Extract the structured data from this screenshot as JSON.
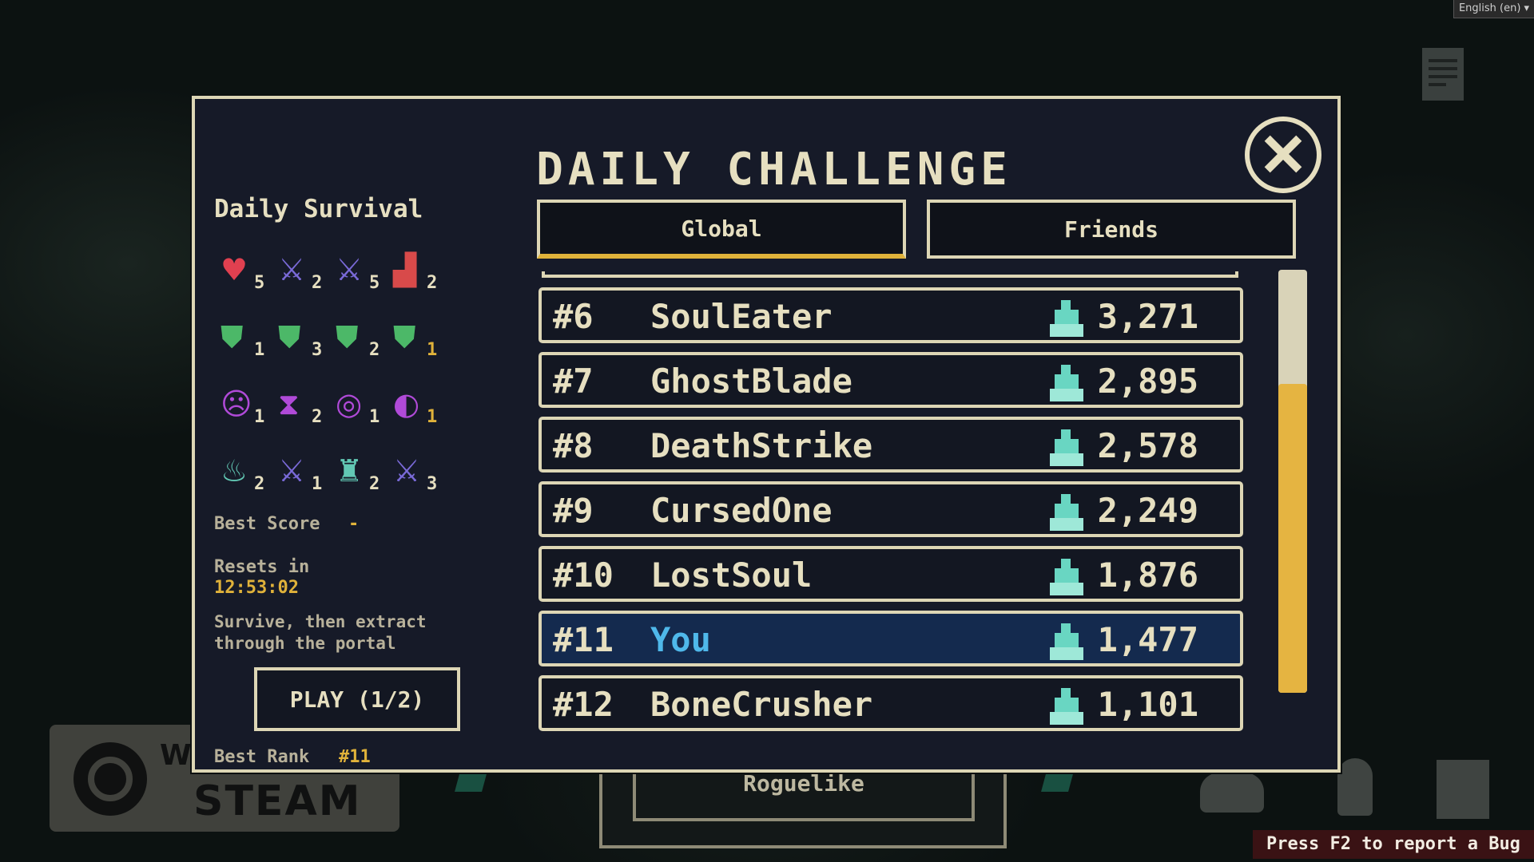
{
  "language_select": "English (en) ▾",
  "background_labels": {
    "steam_top": "WI",
    "steam": "STEAM",
    "under_button": "Roguelike",
    "bug_report": "Press F2 to report a Bug"
  },
  "dialog": {
    "title": "DAILY CHALLENGE",
    "mode_title": "Daily Survival",
    "stats": [
      [
        {
          "icon": "heart-icon",
          "glyph": "♥",
          "color": "#e04050",
          "count": "5"
        },
        {
          "icon": "sword-up-icon",
          "glyph": "⚔",
          "color": "#7a6ad8",
          "count": "2"
        },
        {
          "icon": "sword-bolt-icon",
          "glyph": "⚔",
          "color": "#7a6ad8",
          "count": "5"
        },
        {
          "icon": "boot-icon",
          "glyph": "▟",
          "color": "#d84a4a",
          "count": "2"
        }
      ],
      [
        {
          "icon": "shield-icon",
          "glyph": "⛊",
          "color": "#4cb868",
          "count": "1",
          "count_color": "#e6dfc0"
        },
        {
          "icon": "shield-icon",
          "glyph": "⛊",
          "color": "#4cb868",
          "count": "3",
          "count_color": "#e6dfc0"
        },
        {
          "icon": "shield-icon",
          "glyph": "⛊",
          "color": "#4cb868",
          "count": "2",
          "count_color": "#e6dfc0"
        },
        {
          "icon": "shield-spark-icon",
          "glyph": "⛊",
          "color": "#4cb868",
          "count": "1",
          "count_color": "#e0b23a"
        }
      ],
      [
        {
          "icon": "skull-orb-icon",
          "glyph": "☹",
          "color": "#b04ad8",
          "count": "1",
          "count_color": "#e6dfc0"
        },
        {
          "icon": "hourglass-orb-icon",
          "glyph": "⧗",
          "color": "#b04ad8",
          "count": "2",
          "count_color": "#e6dfc0"
        },
        {
          "icon": "target-orb-icon",
          "glyph": "◎",
          "color": "#b04ad8",
          "count": "1",
          "count_color": "#e6dfc0"
        },
        {
          "icon": "split-orb-icon",
          "glyph": "◐",
          "color": "#b04ad8",
          "count": "1",
          "count_color": "#e0b23a"
        }
      ],
      [
        {
          "icon": "flame-icon",
          "glyph": "♨",
          "color": "#62c8b4",
          "count": "2",
          "count_color": "#e6dfc0"
        },
        {
          "icon": "double-sword-icon",
          "glyph": "⚔",
          "color": "#7a6ad8",
          "count": "1",
          "count_color": "#e6dfc0"
        },
        {
          "icon": "bag-icon",
          "glyph": "♜",
          "color": "#62c8b4",
          "count": "2",
          "count_color": "#e6dfc0"
        },
        {
          "icon": "sword-orb-icon",
          "glyph": "⚔",
          "color": "#7a6ad8",
          "count": "3",
          "count_color": "#e6dfc0"
        }
      ]
    ],
    "best_score_label": "Best Score",
    "best_score_value": "-",
    "resets_label": "Resets in",
    "resets_value": "12:53:02",
    "description": "Survive, then extract through the portal",
    "play_button": "PLAY (1/2)",
    "best_rank_label": "Best Rank",
    "best_rank_value": "#11",
    "tabs": [
      {
        "label": "Global",
        "active": true
      },
      {
        "label": "Friends",
        "active": false
      }
    ],
    "leaderboard": [
      {
        "rank": "#6",
        "name": "SoulEater",
        "score": "3,271",
        "is_you": false
      },
      {
        "rank": "#7",
        "name": "GhostBlade",
        "score": "2,895",
        "is_you": false
      },
      {
        "rank": "#8",
        "name": "DeathStrike",
        "score": "2,578",
        "is_you": false
      },
      {
        "rank": "#9",
        "name": "CursedOne",
        "score": "2,249",
        "is_you": false
      },
      {
        "rank": "#10",
        "name": "LostSoul",
        "score": "1,876",
        "is_you": false
      },
      {
        "rank": "#11",
        "name": "You",
        "score": "1,477",
        "is_you": true
      },
      {
        "rank": "#12",
        "name": "BoneCrusher",
        "score": "1,101",
        "is_you": false
      }
    ],
    "scroll": {
      "thumb_start": 0.27,
      "thumb_end": 1.0
    }
  },
  "colors": {
    "accent": "#e0b23a",
    "panel": "#161a28",
    "border": "#ddd6b5",
    "you_row": "#142a4e",
    "you_name": "#4fb8ea",
    "trophy": "#69d6c2"
  }
}
